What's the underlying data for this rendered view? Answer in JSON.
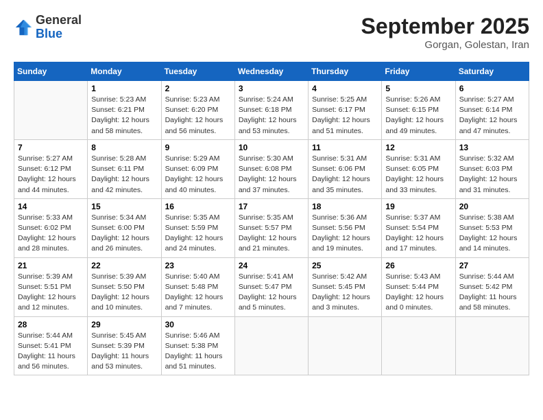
{
  "logo": {
    "general": "General",
    "blue": "Blue"
  },
  "header": {
    "month_year": "September 2025",
    "location": "Gorgan, Golestan, Iran"
  },
  "weekdays": [
    "Sunday",
    "Monday",
    "Tuesday",
    "Wednesday",
    "Thursday",
    "Friday",
    "Saturday"
  ],
  "weeks": [
    [
      {
        "day": "",
        "info": ""
      },
      {
        "day": "1",
        "info": "Sunrise: 5:23 AM\nSunset: 6:21 PM\nDaylight: 12 hours\nand 58 minutes."
      },
      {
        "day": "2",
        "info": "Sunrise: 5:23 AM\nSunset: 6:20 PM\nDaylight: 12 hours\nand 56 minutes."
      },
      {
        "day": "3",
        "info": "Sunrise: 5:24 AM\nSunset: 6:18 PM\nDaylight: 12 hours\nand 53 minutes."
      },
      {
        "day": "4",
        "info": "Sunrise: 5:25 AM\nSunset: 6:17 PM\nDaylight: 12 hours\nand 51 minutes."
      },
      {
        "day": "5",
        "info": "Sunrise: 5:26 AM\nSunset: 6:15 PM\nDaylight: 12 hours\nand 49 minutes."
      },
      {
        "day": "6",
        "info": "Sunrise: 5:27 AM\nSunset: 6:14 PM\nDaylight: 12 hours\nand 47 minutes."
      }
    ],
    [
      {
        "day": "7",
        "info": "Sunrise: 5:27 AM\nSunset: 6:12 PM\nDaylight: 12 hours\nand 44 minutes."
      },
      {
        "day": "8",
        "info": "Sunrise: 5:28 AM\nSunset: 6:11 PM\nDaylight: 12 hours\nand 42 minutes."
      },
      {
        "day": "9",
        "info": "Sunrise: 5:29 AM\nSunset: 6:09 PM\nDaylight: 12 hours\nand 40 minutes."
      },
      {
        "day": "10",
        "info": "Sunrise: 5:30 AM\nSunset: 6:08 PM\nDaylight: 12 hours\nand 37 minutes."
      },
      {
        "day": "11",
        "info": "Sunrise: 5:31 AM\nSunset: 6:06 PM\nDaylight: 12 hours\nand 35 minutes."
      },
      {
        "day": "12",
        "info": "Sunrise: 5:31 AM\nSunset: 6:05 PM\nDaylight: 12 hours\nand 33 minutes."
      },
      {
        "day": "13",
        "info": "Sunrise: 5:32 AM\nSunset: 6:03 PM\nDaylight: 12 hours\nand 31 minutes."
      }
    ],
    [
      {
        "day": "14",
        "info": "Sunrise: 5:33 AM\nSunset: 6:02 PM\nDaylight: 12 hours\nand 28 minutes."
      },
      {
        "day": "15",
        "info": "Sunrise: 5:34 AM\nSunset: 6:00 PM\nDaylight: 12 hours\nand 26 minutes."
      },
      {
        "day": "16",
        "info": "Sunrise: 5:35 AM\nSunset: 5:59 PM\nDaylight: 12 hours\nand 24 minutes."
      },
      {
        "day": "17",
        "info": "Sunrise: 5:35 AM\nSunset: 5:57 PM\nDaylight: 12 hours\nand 21 minutes."
      },
      {
        "day": "18",
        "info": "Sunrise: 5:36 AM\nSunset: 5:56 PM\nDaylight: 12 hours\nand 19 minutes."
      },
      {
        "day": "19",
        "info": "Sunrise: 5:37 AM\nSunset: 5:54 PM\nDaylight: 12 hours\nand 17 minutes."
      },
      {
        "day": "20",
        "info": "Sunrise: 5:38 AM\nSunset: 5:53 PM\nDaylight: 12 hours\nand 14 minutes."
      }
    ],
    [
      {
        "day": "21",
        "info": "Sunrise: 5:39 AM\nSunset: 5:51 PM\nDaylight: 12 hours\nand 12 minutes."
      },
      {
        "day": "22",
        "info": "Sunrise: 5:39 AM\nSunset: 5:50 PM\nDaylight: 12 hours\nand 10 minutes."
      },
      {
        "day": "23",
        "info": "Sunrise: 5:40 AM\nSunset: 5:48 PM\nDaylight: 12 hours\nand 7 minutes."
      },
      {
        "day": "24",
        "info": "Sunrise: 5:41 AM\nSunset: 5:47 PM\nDaylight: 12 hours\nand 5 minutes."
      },
      {
        "day": "25",
        "info": "Sunrise: 5:42 AM\nSunset: 5:45 PM\nDaylight: 12 hours\nand 3 minutes."
      },
      {
        "day": "26",
        "info": "Sunrise: 5:43 AM\nSunset: 5:44 PM\nDaylight: 12 hours\nand 0 minutes."
      },
      {
        "day": "27",
        "info": "Sunrise: 5:44 AM\nSunset: 5:42 PM\nDaylight: 11 hours\nand 58 minutes."
      }
    ],
    [
      {
        "day": "28",
        "info": "Sunrise: 5:44 AM\nSunset: 5:41 PM\nDaylight: 11 hours\nand 56 minutes."
      },
      {
        "day": "29",
        "info": "Sunrise: 5:45 AM\nSunset: 5:39 PM\nDaylight: 11 hours\nand 53 minutes."
      },
      {
        "day": "30",
        "info": "Sunrise: 5:46 AM\nSunset: 5:38 PM\nDaylight: 11 hours\nand 51 minutes."
      },
      {
        "day": "",
        "info": ""
      },
      {
        "day": "",
        "info": ""
      },
      {
        "day": "",
        "info": ""
      },
      {
        "day": "",
        "info": ""
      }
    ]
  ]
}
